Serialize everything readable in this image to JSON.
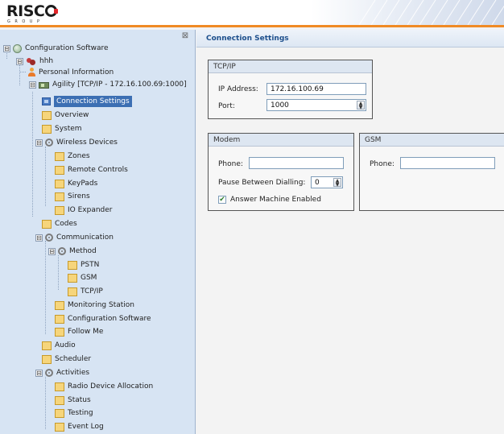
{
  "header": {
    "logo_main": "RISC",
    "logo_sub": "GROUP"
  },
  "tree": {
    "close_glyph": "⊠",
    "items": [
      {
        "label": "Configuration Software",
        "icon": "globe-icon",
        "toggle": "⊟"
      },
      {
        "label": "hhh",
        "icon": "users-icon",
        "toggle": "⊟"
      },
      {
        "label": "Personal Information",
        "icon": "person-icon"
      },
      {
        "label": "Agility [TCP/IP - 172.16.100.69:1000]",
        "icon": "panel-device-icon",
        "toggle": "⊟"
      },
      {
        "label": "Connection Settings",
        "icon": "connection-icon",
        "selected": true
      },
      {
        "label": "Overview",
        "icon": "page-icon"
      },
      {
        "label": "System",
        "icon": "page-icon"
      },
      {
        "label": "Wireless Devices",
        "icon": "gear-icon",
        "toggle": "⊟"
      },
      {
        "label": "Zones",
        "icon": "page-icon"
      },
      {
        "label": "Remote Controls",
        "icon": "page-icon"
      },
      {
        "label": "KeyPads",
        "icon": "page-icon"
      },
      {
        "label": "Sirens",
        "icon": "page-icon"
      },
      {
        "label": "IO Expander",
        "icon": "page-icon"
      },
      {
        "label": "Codes",
        "icon": "page-icon"
      },
      {
        "label": "Communication",
        "icon": "gear-icon",
        "toggle": "⊟"
      },
      {
        "label": "Method",
        "icon": "gear-icon",
        "toggle": "⊟"
      },
      {
        "label": "PSTN",
        "icon": "page-icon"
      },
      {
        "label": "GSM",
        "icon": "page-icon"
      },
      {
        "label": "TCP/IP",
        "icon": "page-icon"
      },
      {
        "label": "Monitoring Station",
        "icon": "page-icon"
      },
      {
        "label": "Configuration Software",
        "icon": "page-icon"
      },
      {
        "label": "Follow Me",
        "icon": "page-icon"
      },
      {
        "label": "Audio",
        "icon": "page-icon"
      },
      {
        "label": "Scheduler",
        "icon": "page-icon"
      },
      {
        "label": "Activities",
        "icon": "gear-icon",
        "toggle": "⊟"
      },
      {
        "label": "Radio Device Allocation",
        "icon": "page-icon"
      },
      {
        "label": "Status",
        "icon": "page-icon"
      },
      {
        "label": "Testing",
        "icon": "page-icon"
      },
      {
        "label": "Event Log",
        "icon": "page-icon"
      }
    ]
  },
  "content": {
    "title": "Connection Settings",
    "tcpip": {
      "title": "TCP/IP",
      "ip_label": "IP Address:",
      "ip_value": "172.16.100.69",
      "port_label": "Port:",
      "port_value": "1000"
    },
    "modem": {
      "title": "Modem",
      "phone_label": "Phone:",
      "phone_value": "",
      "pause_label": "Pause Between Dialling:",
      "pause_value": "0",
      "answer_label": "Answer Machine Enabled",
      "answer_checked": true
    },
    "gsm": {
      "title": "GSM",
      "phone_label": "Phone:",
      "phone_value": ""
    }
  },
  "colors": {
    "accent_orange": "#f08a24",
    "tree_bg": "#d7e4f3",
    "selection": "#3c6fb3",
    "title_text": "#1d4f8c"
  }
}
